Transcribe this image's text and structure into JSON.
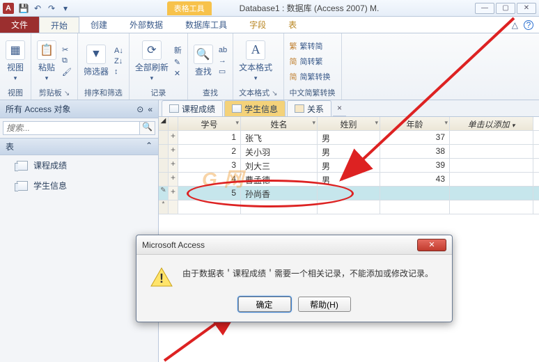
{
  "window": {
    "app_letter": "A",
    "doc_title": "Database1 : 数据库 (Access 2007) M.",
    "tools_badge": "表格工具"
  },
  "ribbon_tabs": {
    "file": "文件",
    "home": "开始",
    "create": "创建",
    "external": "外部数据",
    "dbtools": "数据库工具",
    "fields": "字段",
    "table": "表"
  },
  "ribbon": {
    "view": "视图",
    "paste": "粘贴",
    "clipboard_label": "剪贴板",
    "filter": "筛选器",
    "sort_label": "排序和筛选",
    "refresh": "全部刷新",
    "records_label": "记录",
    "find": "查找",
    "textfmt": "文本格式",
    "chs": {
      "s2t": "繁转简",
      "t2s": "简转繁",
      "both": "简繁转换",
      "label": "中文简繁转换"
    },
    "sort_icons": {
      "asc": "A↓",
      "desc": "Z↓",
      "clear": "↕"
    },
    "records_icons": {
      "new": "新",
      "save": "✎",
      "delete": "✕"
    },
    "find_icons": {
      "replace": "ab",
      "goto": "→",
      "select": "▭"
    }
  },
  "nav": {
    "header": "所有 Access 对象",
    "search_placeholder": "搜索...",
    "section_tables": "表",
    "items": [
      "课程成绩",
      "学生信息"
    ]
  },
  "doc_tabs": [
    "课程成绩",
    "学生信息",
    "关系"
  ],
  "grid": {
    "columns": {
      "id": "学号",
      "name": "姓名",
      "gender": "姓别",
      "age": "年龄",
      "add": "单击以添加"
    },
    "rows": [
      {
        "id": "1",
        "name": "张飞",
        "gender": "男",
        "age": "37"
      },
      {
        "id": "2",
        "name": "关小羽",
        "gender": "男",
        "age": "38"
      },
      {
        "id": "3",
        "name": "刘大三",
        "gender": "男",
        "age": "39"
      },
      {
        "id": "4",
        "name": "曹孟德",
        "gender": "男",
        "age": "43"
      },
      {
        "id": "5",
        "name": "孙尚香",
        "gender": "",
        "age": ""
      }
    ]
  },
  "dialog": {
    "title": "Microsoft Access",
    "message": "由于数据表＇课程成绩＇需要一个相关记录，不能添加或修改记录。",
    "ok": "确定",
    "help": "帮助(H)"
  },
  "watermark": "G 网"
}
